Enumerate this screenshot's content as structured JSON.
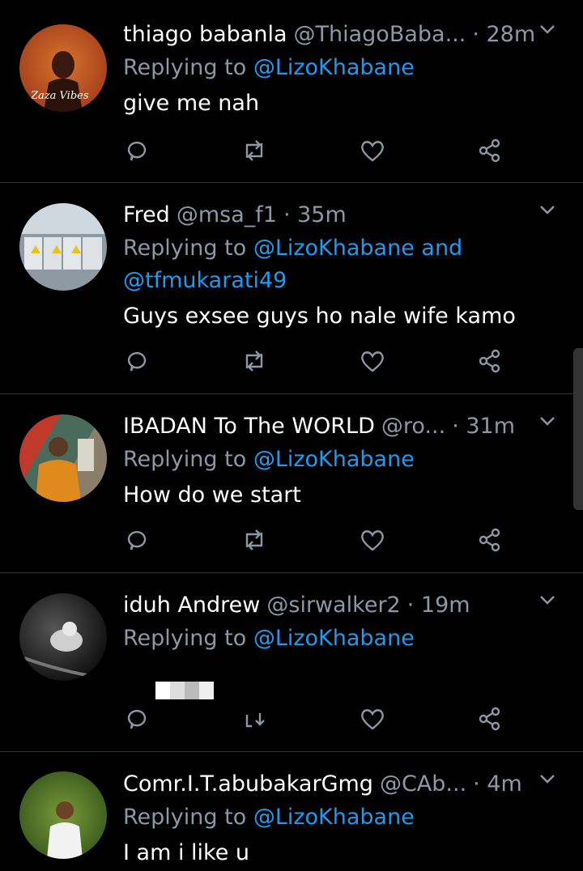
{
  "tweets": [
    {
      "name": "thiago babanla",
      "handle": "@ThiagoBaba...",
      "time": "· 28m",
      "reply_prefix": "Replying to ",
      "reply_mentions": "@LizoKhabane",
      "reply_mentions2": "",
      "text": "give me nah",
      "avatar_text": "Zaza Vibes"
    },
    {
      "name": "Fred",
      "handle": "@msa_f1",
      "time": "· 35m",
      "reply_prefix": "Replying to ",
      "reply_mentions": "@LizoKhabane and",
      "reply_mentions2": "@tfmukarati49",
      "text": "Guys exsee guys ho nale wife kamo",
      "avatar_text": ""
    },
    {
      "name": "IBADAN To The WORLD",
      "handle": "@ro...",
      "time": "· 31m",
      "reply_prefix": "Replying to ",
      "reply_mentions": "@LizoKhabane",
      "reply_mentions2": "",
      "text": "How do we start",
      "avatar_text": ""
    },
    {
      "name": "iduh Andrew",
      "handle": "@sirwalker2",
      "time": "· 19m",
      "reply_prefix": "Replying to ",
      "reply_mentions": "@LizoKhabane",
      "reply_mentions2": "",
      "text": "",
      "avatar_text": ""
    },
    {
      "name": "Comr.I.T.abubakarGmg",
      "handle": "@CAb...",
      "time": "· 4m",
      "reply_prefix": "Replying to ",
      "reply_mentions": "@LizoKhabane",
      "reply_mentions2": "",
      "text": "I am i like u",
      "avatar_text": ""
    }
  ],
  "icons": [
    "reply-icon",
    "retweet-icon",
    "like-icon",
    "share-icon",
    "chevron-down-icon"
  ],
  "colors": {
    "background": "#000000",
    "mention": "#1d9bf0",
    "muted": "#8b98a5",
    "divider": "#2f3336"
  }
}
